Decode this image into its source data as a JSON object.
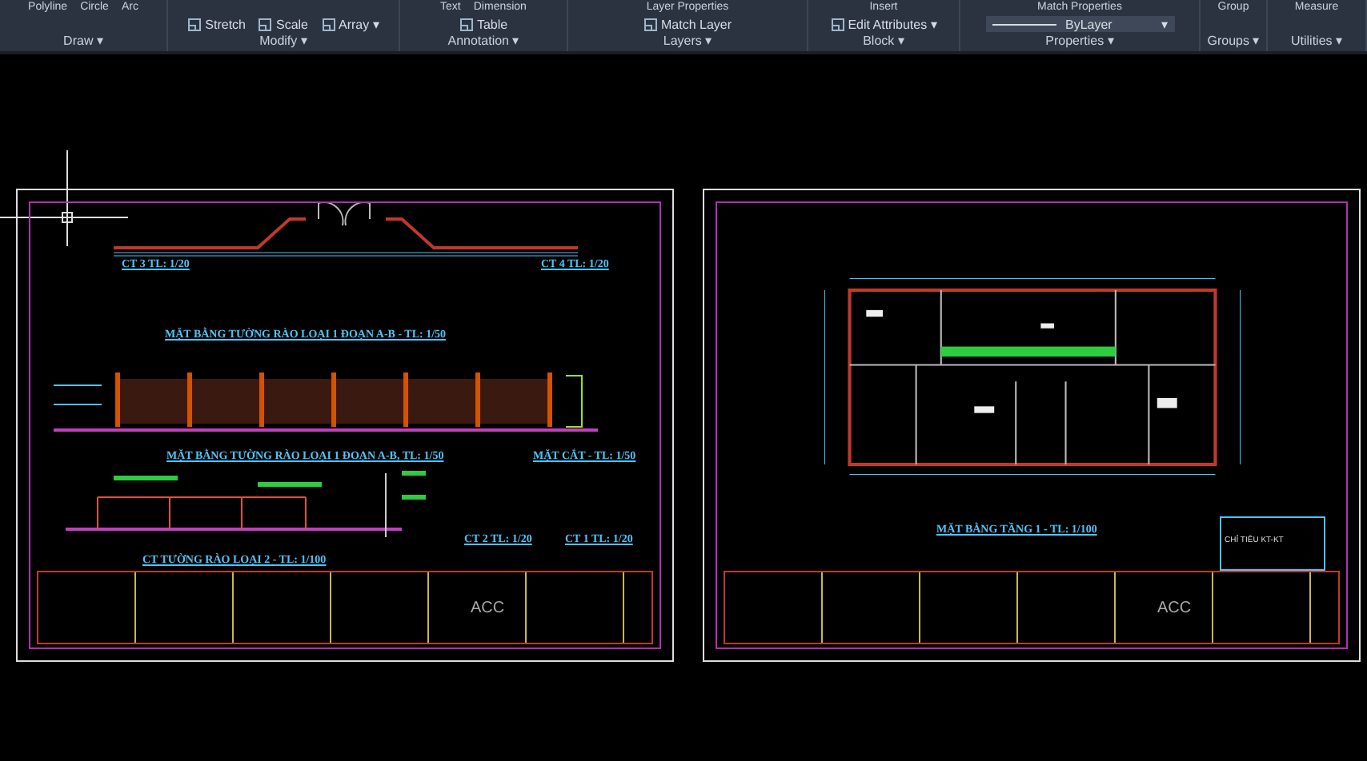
{
  "ribbon": {
    "panels": [
      {
        "label": "Draw ▾",
        "top": [
          "Polyline",
          "Circle",
          "Arc"
        ]
      },
      {
        "label": "Modify ▾",
        "tools": [
          "Stretch",
          "Scale",
          "Array ▾"
        ]
      },
      {
        "label": "Annotation ▾",
        "top": [
          "Text",
          "Dimension"
        ],
        "tools": [
          "Table"
        ]
      },
      {
        "label": "Layers ▾",
        "top": [
          "Layer Properties"
        ],
        "tools": [
          "Match Layer"
        ]
      },
      {
        "label": "Block ▾",
        "top": [
          "Insert"
        ],
        "tools": [
          "Edit Attributes ▾"
        ]
      },
      {
        "label": "Properties ▾",
        "top": [
          "Match Properties"
        ],
        "dropdown": {
          "value": "ByLayer",
          "caret": "▾"
        }
      },
      {
        "label": "Groups ▾",
        "top": [
          "Group"
        ]
      },
      {
        "label": "Utilities ▾",
        "top": [
          "Measure"
        ]
      }
    ]
  },
  "sheets": [
    {
      "kind": "fence",
      "labels": [
        "CT 3 TL: 1/20",
        "CT 4 TL: 1/20",
        "MẶT BẰNG TƯỜNG RÀO LOẠI 1 ĐOẠN A-B - TL: 1/50",
        "MẶT BẰNG TƯỜNG RÀO LOẠI 1 ĐOẠN A-B, TL: 1/50",
        "MẶT CẮT - TL: 1/50",
        "CT 2 TL: 1/20",
        "CT 1 TL: 1/20",
        "CT TƯỜNG RÀO LOẠI 2 - TL: 1/100"
      ],
      "company": "ACC"
    },
    {
      "kind": "floor_plan",
      "labels": [
        "MẶT BẰNG TẦNG 1 - TL: 1/100"
      ],
      "notes_title": "CHỈ TIÊU KT-KT",
      "company": "ACC"
    }
  ]
}
